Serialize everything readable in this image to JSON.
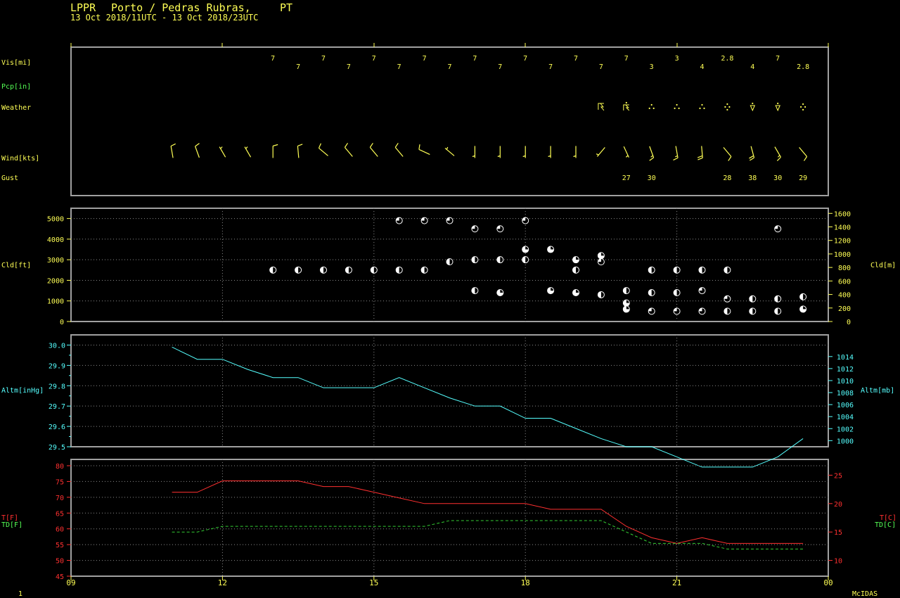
{
  "header": {
    "station": "LPPR",
    "station_name": "Porto / Pedras Rubras,",
    "country": "PT",
    "period": "13 Oct 2018/11UTC - 13 Oct 2018/23UTC"
  },
  "footer": {
    "left": "1",
    "right": "McIDAS"
  },
  "colors": {
    "yellow": "#ffff55",
    "green": "#55ff55",
    "cyan": "#55ffff",
    "red": "#ff3030",
    "grid": "#8a8a8a",
    "frame": "#a0a0a0"
  },
  "x_axis": {
    "range_hours": [
      9,
      24
    ],
    "ticks": [
      9,
      12,
      15,
      18,
      21,
      24
    ],
    "tick_labels": [
      "09",
      "12",
      "15",
      "18",
      "21",
      "00"
    ]
  },
  "chart_data": [
    {
      "type": "table",
      "panel": "surface-observations",
      "row_labels": {
        "vis": "Vis[mi]",
        "pcp": "Pcp[in]",
        "weather": "Weather",
        "wind": "Wind[kts]",
        "gust": "Gust"
      },
      "visibility": [
        {
          "t": 13.0,
          "v": "7"
        },
        {
          "t": 13.5,
          "v": "7"
        },
        {
          "t": 14.0,
          "v": "7"
        },
        {
          "t": 14.5,
          "v": "7"
        },
        {
          "t": 15.0,
          "v": "7"
        },
        {
          "t": 15.5,
          "v": "7"
        },
        {
          "t": 16.0,
          "v": "7"
        },
        {
          "t": 16.5,
          "v": "7"
        },
        {
          "t": 17.0,
          "v": "7"
        },
        {
          "t": 17.5,
          "v": "7"
        },
        {
          "t": 18.0,
          "v": "7"
        },
        {
          "t": 18.5,
          "v": "7"
        },
        {
          "t": 19.0,
          "v": "7"
        },
        {
          "t": 19.5,
          "v": "7"
        },
        {
          "t": 20.0,
          "v": "7"
        },
        {
          "t": 20.5,
          "v": "3"
        },
        {
          "t": 21.0,
          "v": "3"
        },
        {
          "t": 21.5,
          "v": "4"
        },
        {
          "t": 22.0,
          "v": "2.8"
        },
        {
          "t": 22.5,
          "v": "4"
        },
        {
          "t": 23.0,
          "v": "7"
        },
        {
          "t": 23.5,
          "v": "2.8"
        }
      ],
      "weather": [
        {
          "t": 19.5,
          "symbol": "thunderstorm"
        },
        {
          "t": 20.0,
          "symbol": "thunderstorm-rain"
        },
        {
          "t": 20.5,
          "symbol": "rain"
        },
        {
          "t": 21.0,
          "symbol": "rain"
        },
        {
          "t": 21.5,
          "symbol": "rain"
        },
        {
          "t": 22.0,
          "symbol": "moderate-rain"
        },
        {
          "t": 22.5,
          "symbol": "rain-shower"
        },
        {
          "t": 23.0,
          "symbol": "rain-shower"
        },
        {
          "t": 23.5,
          "symbol": "moderate-rain"
        }
      ],
      "wind": [
        {
          "t": 11.0,
          "dir": 350,
          "spd": 10
        },
        {
          "t": 11.5,
          "dir": 340,
          "spd": 10
        },
        {
          "t": 12.0,
          "dir": 330,
          "spd": 5
        },
        {
          "t": 12.5,
          "dir": 330,
          "spd": 5
        },
        {
          "t": 13.0,
          "dir": 360,
          "spd": 10
        },
        {
          "t": 13.5,
          "dir": 355,
          "spd": 10
        },
        {
          "t": 14.0,
          "dir": 310,
          "spd": 10
        },
        {
          "t": 14.5,
          "dir": 320,
          "spd": 10
        },
        {
          "t": 15.0,
          "dir": 320,
          "spd": 10
        },
        {
          "t": 15.5,
          "dir": 320,
          "spd": 10
        },
        {
          "t": 16.0,
          "dir": 295,
          "spd": 10
        },
        {
          "t": 16.5,
          "dir": 310,
          "spd": 5
        },
        {
          "t": 17.0,
          "dir": 180,
          "spd": 5
        },
        {
          "t": 17.5,
          "dir": 180,
          "spd": 5
        },
        {
          "t": 18.0,
          "dir": 180,
          "spd": 5
        },
        {
          "t": 18.5,
          "dir": 180,
          "spd": 5
        },
        {
          "t": 19.0,
          "dir": 180,
          "spd": 5
        },
        {
          "t": 19.5,
          "dir": 220,
          "spd": 5
        },
        {
          "t": 20.0,
          "dir": 155,
          "spd": 5
        },
        {
          "t": 20.5,
          "dir": 160,
          "spd": 15
        },
        {
          "t": 21.0,
          "dir": 170,
          "spd": 15
        },
        {
          "t": 21.5,
          "dir": 175,
          "spd": 20
        },
        {
          "t": 22.0,
          "dir": 140,
          "spd": 10
        },
        {
          "t": 22.5,
          "dir": 165,
          "spd": 20
        },
        {
          "t": 23.0,
          "dir": 150,
          "spd": 15
        },
        {
          "t": 23.5,
          "dir": 140,
          "spd": 10
        }
      ],
      "gust": [
        {
          "t": 20.0,
          "v": "27"
        },
        {
          "t": 20.5,
          "v": "30"
        },
        {
          "t": 22.0,
          "v": "28"
        },
        {
          "t": 22.5,
          "v": "38"
        },
        {
          "t": 23.0,
          "v": "30"
        },
        {
          "t": 23.5,
          "v": "29"
        }
      ]
    },
    {
      "type": "scatter",
      "panel": "cloud-layers",
      "ylabel": "Cld[ft]",
      "ylabel_right": "Cld[m]",
      "ylim": [
        0,
        5500
      ],
      "yticks": [
        0,
        1000,
        2000,
        3000,
        4000,
        5000
      ],
      "ylim_right": [
        0,
        1676
      ],
      "yticks_right": [
        0,
        200,
        400,
        600,
        800,
        1000,
        1200,
        1400,
        1600
      ],
      "points": [
        {
          "t": 13.0,
          "h": 2500,
          "c": "sct"
        },
        {
          "t": 13.5,
          "h": 2500,
          "c": "sct"
        },
        {
          "t": 14.0,
          "h": 2500,
          "c": "sct"
        },
        {
          "t": 14.5,
          "h": 2500,
          "c": "sct"
        },
        {
          "t": 15.0,
          "h": 2500,
          "c": "sct"
        },
        {
          "t": 15.5,
          "h": 2500,
          "c": "sct"
        },
        {
          "t": 16.0,
          "h": 2500,
          "c": "sct"
        },
        {
          "t": 15.5,
          "h": 4900,
          "c": "bkn"
        },
        {
          "t": 16.0,
          "h": 4900,
          "c": "bkn"
        },
        {
          "t": 16.5,
          "h": 4900,
          "c": "bkn"
        },
        {
          "t": 16.5,
          "h": 2900,
          "c": "sct"
        },
        {
          "t": 17.0,
          "h": 4500,
          "c": "bkn"
        },
        {
          "t": 17.0,
          "h": 3000,
          "c": "sct"
        },
        {
          "t": 17.0,
          "h": 1500,
          "c": "sct"
        },
        {
          "t": 17.5,
          "h": 4500,
          "c": "bkn"
        },
        {
          "t": 17.5,
          "h": 3000,
          "c": "sct"
        },
        {
          "t": 17.5,
          "h": 1400,
          "c": "few"
        },
        {
          "t": 18.0,
          "h": 4900,
          "c": "bkn"
        },
        {
          "t": 18.0,
          "h": 3500,
          "c": "few"
        },
        {
          "t": 18.0,
          "h": 3000,
          "c": "sct"
        },
        {
          "t": 18.5,
          "h": 3500,
          "c": "few"
        },
        {
          "t": 18.5,
          "h": 1500,
          "c": "few"
        },
        {
          "t": 19.0,
          "h": 3000,
          "c": "few"
        },
        {
          "t": 19.0,
          "h": 2500,
          "c": "sct"
        },
        {
          "t": 19.0,
          "h": 1400,
          "c": "few"
        },
        {
          "t": 19.5,
          "h": 3200,
          "c": "few"
        },
        {
          "t": 19.5,
          "h": 2900,
          "c": "bkn"
        },
        {
          "t": 19.5,
          "h": 1300,
          "c": "sct"
        },
        {
          "t": 20.0,
          "h": 1500,
          "c": "sct"
        },
        {
          "t": 20.0,
          "h": 900,
          "c": "few"
        },
        {
          "t": 20.0,
          "h": 600,
          "c": "few"
        },
        {
          "t": 20.5,
          "h": 2500,
          "c": "sct"
        },
        {
          "t": 20.5,
          "h": 1400,
          "c": "sct"
        },
        {
          "t": 20.5,
          "h": 500,
          "c": "bkn"
        },
        {
          "t": 21.0,
          "h": 2500,
          "c": "sct"
        },
        {
          "t": 21.0,
          "h": 1400,
          "c": "sct"
        },
        {
          "t": 21.0,
          "h": 500,
          "c": "bkn"
        },
        {
          "t": 21.5,
          "h": 2500,
          "c": "sct"
        },
        {
          "t": 21.5,
          "h": 1500,
          "c": "bkn"
        },
        {
          "t": 21.5,
          "h": 500,
          "c": "bkn"
        },
        {
          "t": 22.0,
          "h": 2500,
          "c": "sct"
        },
        {
          "t": 22.0,
          "h": 1100,
          "c": "bkn"
        },
        {
          "t": 22.0,
          "h": 500,
          "c": "sct"
        },
        {
          "t": 22.5,
          "h": 1100,
          "c": "sct"
        },
        {
          "t": 22.5,
          "h": 500,
          "c": "sct"
        },
        {
          "t": 23.0,
          "h": 4500,
          "c": "bkn"
        },
        {
          "t": 23.0,
          "h": 1100,
          "c": "sct"
        },
        {
          "t": 23.0,
          "h": 500,
          "c": "sct"
        },
        {
          "t": 23.5,
          "h": 1200,
          "c": "sct"
        },
        {
          "t": 23.5,
          "h": 600,
          "c": "few"
        }
      ]
    },
    {
      "type": "line",
      "panel": "altimeter",
      "ylabel": "Altm[inHg]",
      "ylabel_right": "Altm[mb]",
      "ylim": [
        29.5,
        30.05
      ],
      "yticks": [
        29.5,
        29.6,
        29.7,
        29.8,
        29.9,
        30.0
      ],
      "ytick_labels": [
        "29.5",
        "29.6",
        "29.7",
        "29.8",
        "29.9",
        "30.0"
      ],
      "yticks_right": [
        1000,
        1002,
        1004,
        1006,
        1008,
        1010,
        1012,
        1014
      ],
      "x": [
        11.0,
        11.5,
        12.0,
        12.5,
        13.0,
        13.5,
        14.0,
        14.5,
        15.0,
        15.5,
        16.0,
        16.5,
        17.0,
        17.5,
        18.0,
        18.5,
        19.0,
        19.5,
        20.0,
        20.5,
        21.0,
        21.5,
        22.0,
        22.5,
        23.0,
        23.5
      ],
      "values": [
        29.99,
        29.93,
        29.93,
        29.88,
        29.84,
        29.84,
        29.79,
        29.79,
        29.79,
        29.84,
        29.79,
        29.74,
        29.7,
        29.7,
        29.64,
        29.64,
        29.59,
        29.54,
        29.5,
        29.5,
        29.45,
        29.4,
        29.4,
        29.4,
        29.45,
        29.54
      ]
    },
    {
      "type": "line",
      "panel": "temperature",
      "ylabel": "T[F]",
      "ylabel2": "TD[F]",
      "ylabel_right": "T[C]",
      "ylabel_right2": "TD[C]",
      "ylim": [
        45,
        82
      ],
      "yticks": [
        45,
        50,
        55,
        60,
        65,
        70,
        75,
        80
      ],
      "yticks_right": [
        10,
        15,
        20,
        25
      ],
      "x": [
        11.0,
        11.5,
        12.0,
        12.5,
        13.0,
        13.5,
        14.0,
        14.5,
        15.0,
        15.5,
        16.0,
        16.5,
        17.0,
        17.5,
        18.0,
        18.5,
        19.0,
        19.5,
        20.0,
        20.5,
        21.0,
        21.5,
        22.0,
        22.5,
        23.0,
        23.5
      ],
      "series": [
        {
          "name": "T[F]",
          "color": "#ff3030",
          "dashed": false,
          "values": [
            71.6,
            71.6,
            75.2,
            75.2,
            75.2,
            75.2,
            73.4,
            73.4,
            71.6,
            69.8,
            68.0,
            68.0,
            68.0,
            68.0,
            68.0,
            66.2,
            66.2,
            66.2,
            60.8,
            57.2,
            55.4,
            57.2,
            55.4,
            55.4,
            55.4,
            55.4
          ]
        },
        {
          "name": "TD[F]",
          "color": "#33cc33",
          "dashed": true,
          "values": [
            59.0,
            59.0,
            60.8,
            60.8,
            60.8,
            60.8,
            60.8,
            60.8,
            60.8,
            60.8,
            60.8,
            62.6,
            62.6,
            62.6,
            62.6,
            62.6,
            62.6,
            62.6,
            59.0,
            55.4,
            55.4,
            55.4,
            53.6,
            53.6,
            53.6,
            53.6
          ]
        }
      ]
    }
  ]
}
